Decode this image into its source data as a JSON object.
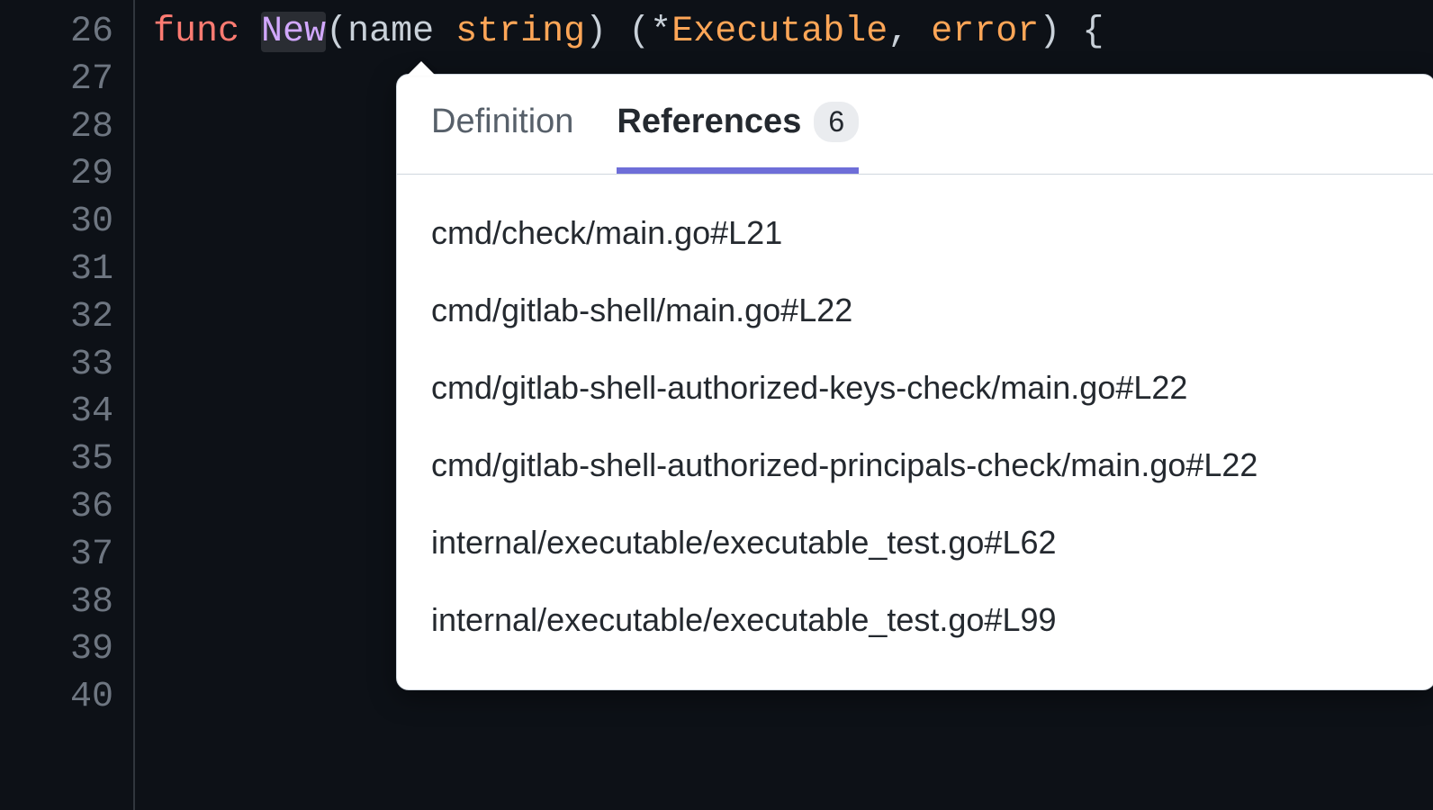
{
  "line_numbers": [
    "26",
    "27",
    "28",
    "29",
    "30",
    "31",
    "32",
    "33",
    "34",
    "35",
    "36",
    "37",
    "38",
    "39",
    "40"
  ],
  "code": {
    "keyword_func": "func",
    "func_name": "New",
    "open_paren": "(",
    "param_name": "name",
    "param_type": "string",
    "close_paren": ")",
    "ret_open": "(",
    "star": "*",
    "ret_type1": "Executable",
    "comma": ",",
    "ret_type2": "error",
    "ret_close": ")",
    "brace_open": "{"
  },
  "popover": {
    "tabs": {
      "definition": "Definition",
      "references": "References",
      "references_count": "6"
    },
    "references": [
      "cmd/check/main.go#L21",
      "cmd/gitlab-shell/main.go#L22",
      "cmd/gitlab-shell-authorized-keys-check/main.go#L22",
      "cmd/gitlab-shell-authorized-principals-check/main.go#L22",
      "internal/executable/executable_test.go#L62",
      "internal/executable/executable_test.go#L99"
    ]
  }
}
